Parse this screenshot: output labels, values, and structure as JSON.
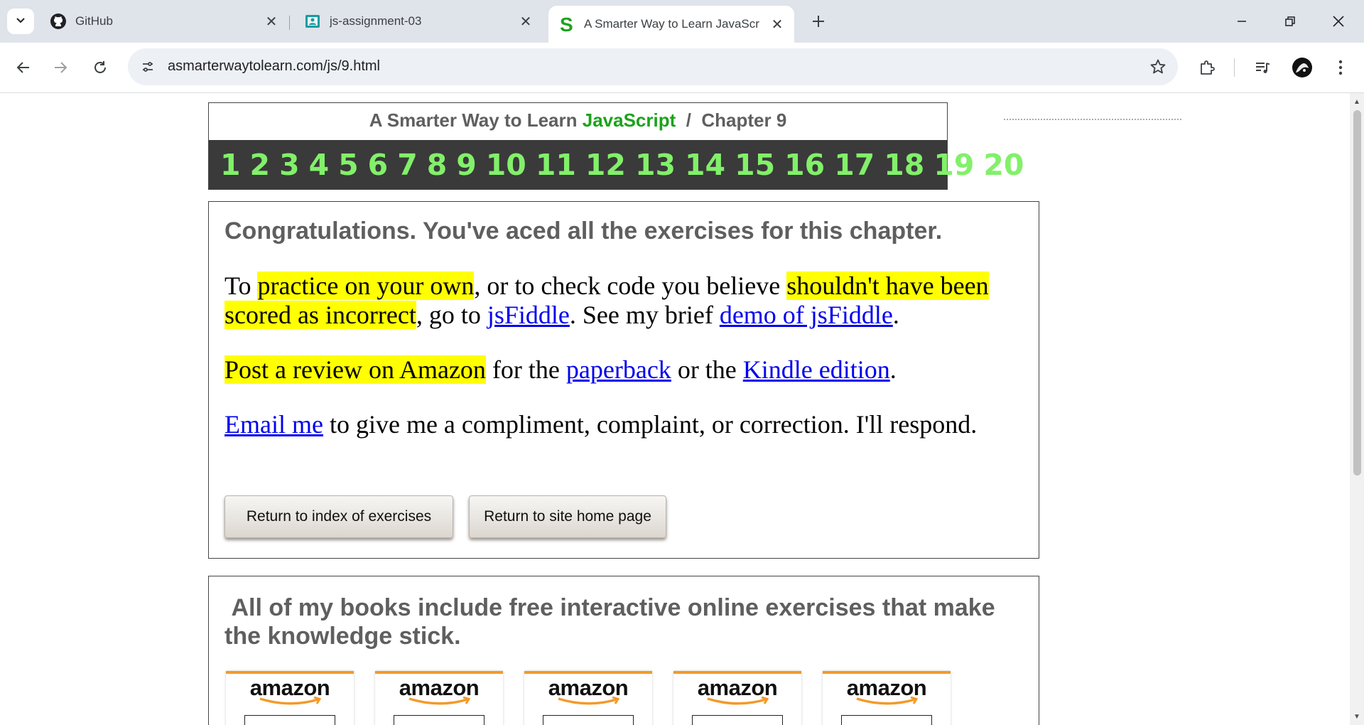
{
  "browser": {
    "tabs": [
      {
        "title": "GitHub",
        "icon": "github-icon"
      },
      {
        "title": "js-assignment-03",
        "icon": "classroom-icon"
      },
      {
        "title": "A Smarter Way to Learn JavaScr",
        "icon": "smarter-way-s-icon",
        "active": true
      }
    ],
    "url": "asmarterwaytolearn.com/js/9.html"
  },
  "header": {
    "title_pre": "A Smarter Way to Learn ",
    "title_js": "JavaScript",
    "title_post": "  /  Chapter 9",
    "chapters": [
      "1",
      "2",
      "3",
      "4",
      "5",
      "6",
      "7",
      "8",
      "9",
      "10",
      "11",
      "12",
      "13",
      "14",
      "15",
      "16",
      "17",
      "18",
      "19",
      "20"
    ]
  },
  "main": {
    "congrats": "Congratulations. You've aced all the exercises for this chapter.",
    "p1": {
      "t1": "To ",
      "h1": "practice on your own",
      "t2": ", or to check code you believe ",
      "h2": "shouldn't have been scored as incorrect",
      "t3": ", go to ",
      "l1": "jsFiddle",
      "t4": ". See my brief ",
      "l2": "demo of jsFiddle",
      "t5": "."
    },
    "p2": {
      "h1": "Post a review on Amazon",
      "t1": " for the ",
      "l1": "paperback",
      "t2": " or the ",
      "l2": "Kindle edition",
      "t3": "."
    },
    "p3": {
      "l1": "Email me",
      "t1": " to give me a compliment, complaint, or correction. I'll respond."
    },
    "buttons": {
      "index": "Return to index of exercises",
      "home": "Return to site home page"
    }
  },
  "books": {
    "title": "All of my books include free interactive online exercises that make the knowledge stick.",
    "amazon_label": "amazon",
    "count": 5
  },
  "colors": {
    "javascript_green": "#1ba31b",
    "chapter_numbers": "#82f06a",
    "highlight": "#ffff00",
    "link": "#0000ee"
  }
}
